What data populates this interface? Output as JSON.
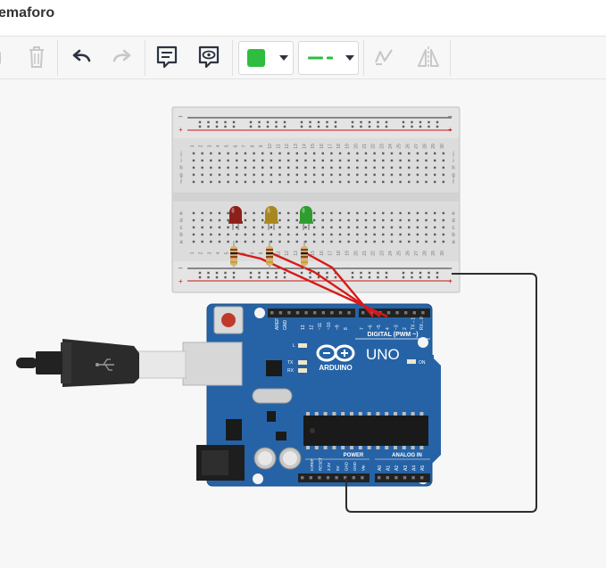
{
  "window": {
    "title": "emaforo"
  },
  "toolbar": {
    "fill_color": "#2ebd3e",
    "line_color": "#2ebd3e",
    "buttons": [
      "rotate-icon",
      "delete-icon",
      "undo-icon",
      "redo-icon",
      "note-icon",
      "annotation-toggle-icon",
      "align-icon",
      "flip-icon"
    ]
  },
  "breadboard": {
    "column_numbers": [
      "1",
      "2",
      "3",
      "4",
      "5",
      "6",
      "7",
      "8",
      "9",
      "10",
      "11",
      "12",
      "13",
      "14",
      "15",
      "16",
      "17",
      "18",
      "19",
      "20",
      "21",
      "22",
      "23",
      "24",
      "25",
      "26",
      "27",
      "28",
      "29",
      "30"
    ],
    "top_row_letters": [
      "j",
      "i",
      "h",
      "g",
      "f"
    ],
    "bottom_row_letters": [
      "e",
      "d",
      "c",
      "b",
      "a"
    ],
    "rail_minus": "–",
    "rail_plus": "+"
  },
  "leds": [
    {
      "color": "#8d1f1a"
    },
    {
      "color": "#a8871f"
    },
    {
      "color": "#2e9c2e"
    }
  ],
  "arduino": {
    "brand_text": "ARDUINO",
    "model_text": "UNO",
    "digital_label": "DIGITAL (PWM ~)",
    "power_label": "POWER",
    "analog_label": "ANALOG IN",
    "on_label": "ON",
    "l_label": "L",
    "tx_label": "TX",
    "rx_label": "RX",
    "aref_label": "AREF",
    "gnd_label": "GND",
    "digital_pins": [
      "13",
      "12",
      "~11",
      "~10",
      "~9",
      "8",
      "7",
      "~6",
      "~5",
      "4",
      "~3",
      "2",
      "TX→1",
      "RX←0"
    ],
    "power_pins": [
      "IOREF",
      "RESET",
      "3.3V",
      "5V",
      "GND",
      "GND",
      "Vin"
    ],
    "analog_pins": [
      "A0",
      "A1",
      "A2",
      "A3",
      "A4",
      "A5"
    ]
  }
}
